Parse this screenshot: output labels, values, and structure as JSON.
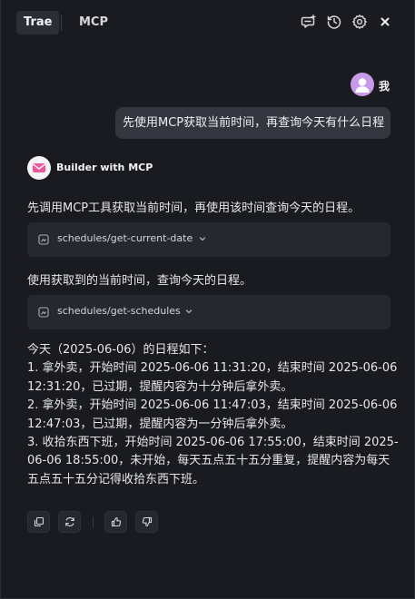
{
  "header": {
    "tabs": [
      {
        "label": "Trae",
        "active": true
      },
      {
        "label": "MCP",
        "active": false
      }
    ],
    "icons": [
      "new-chat-icon",
      "history-icon",
      "settings-icon",
      "close-icon"
    ]
  },
  "user": {
    "name": "我",
    "message": "先使用MCP获取当前时间，再查询今天有什么日程"
  },
  "assistant": {
    "name": "Builder with MCP",
    "intro": "先调用MCP工具获取当前时间，再使用该时间查询今天的日程。",
    "tool_calls": [
      {
        "name": "schedules/get-current-date"
      },
      {
        "name": "schedules/get-schedules"
      }
    ],
    "mid": "使用获取到的当前时间，查询今天的日程。",
    "result_lines": [
      "今天（2025-06-06）的日程如下：",
      "1. 拿外卖，开始时间 2025-06-06 11:31:20，结束时间 2025-06-06",
      "12:31:20，已过期，提醒内容为十分钟后拿外卖。",
      "2. 拿外卖，开始时间 2025-06-06 11:47:03，结束时间 2025-06-06",
      "12:47:03，已过期，提醒内容为一分钟后拿外卖。",
      "3. 收拾东西下班，开始时间 2025-06-06 17:55:00，结束时间 2025-",
      "06-06 18:55:00，未开始，每天五点五十五分重复，提醒内容为每天",
      "五点五十五分记得收拾东西下班。"
    ],
    "actions": [
      "copy-icon",
      "regenerate-icon",
      "thumbs-up-icon",
      "thumbs-down-icon"
    ]
  },
  "colors": {
    "background": "#1a1b20",
    "bubble": "#33363f",
    "tool_card": "#262830",
    "user_avatar": "#c79be8",
    "bot_avatar_accent": "#e85a9b"
  }
}
